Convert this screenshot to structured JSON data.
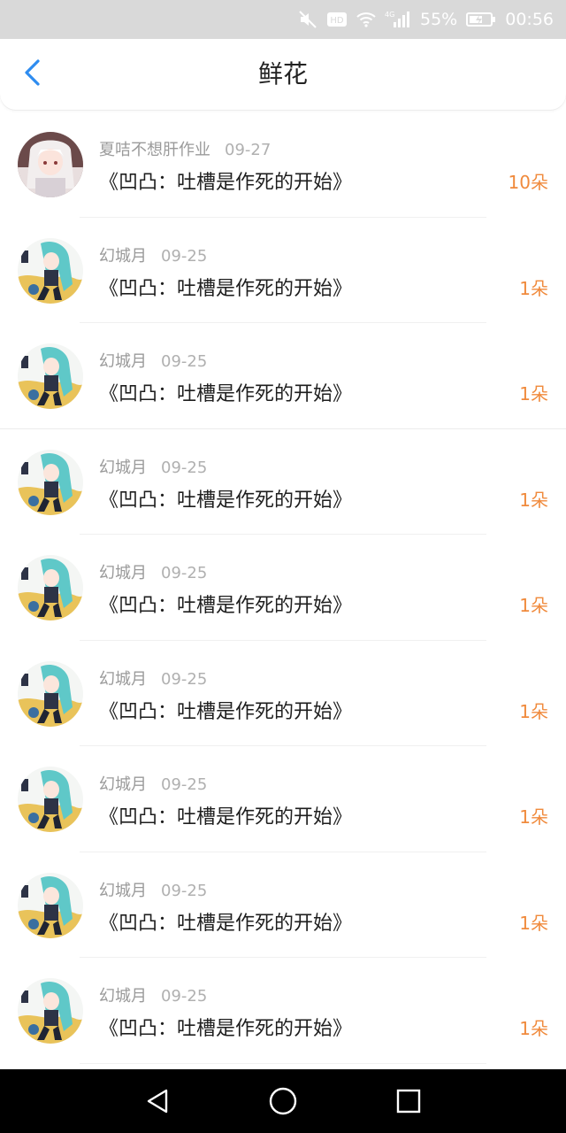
{
  "status_bar": {
    "battery_percent": "55%",
    "time": "00:56",
    "network_label": "HD",
    "signal_label": "4G"
  },
  "header": {
    "title": "鲜花",
    "back_icon": "chevron-left-icon",
    "accent_color": "#2e8cf0"
  },
  "accent_count_color": "#f08a3c",
  "items": [
    {
      "user": "夏咭不想肝作业",
      "date": "09-27",
      "work": "《凹凸：吐槽是作死的开始》",
      "count": "10朵"
    },
    {
      "user": "幻城月",
      "date": "09-25",
      "work": "《凹凸：吐槽是作死的开始》",
      "count": "1朵"
    },
    {
      "user": "幻城月",
      "date": "09-25",
      "work": "《凹凸：吐槽是作死的开始》",
      "count": "1朵"
    },
    {
      "user": "幻城月",
      "date": "09-25",
      "work": "《凹凸：吐槽是作死的开始》",
      "count": "1朵"
    },
    {
      "user": "幻城月",
      "date": "09-25",
      "work": "《凹凸：吐槽是作死的开始》",
      "count": "1朵"
    },
    {
      "user": "幻城月",
      "date": "09-25",
      "work": "《凹凸：吐槽是作死的开始》",
      "count": "1朵"
    },
    {
      "user": "幻城月",
      "date": "09-25",
      "work": "《凹凸：吐槽是作死的开始》",
      "count": "1朵"
    },
    {
      "user": "幻城月",
      "date": "09-25",
      "work": "《凹凸：吐槽是作死的开始》",
      "count": "1朵"
    },
    {
      "user": "幻城月",
      "date": "09-25",
      "work": "《凹凸：吐槽是作死的开始》",
      "count": "1朵"
    }
  ],
  "nav_bar": {
    "back": "triangle-back-icon",
    "home": "circle-home-icon",
    "recents": "square-recents-icon"
  }
}
